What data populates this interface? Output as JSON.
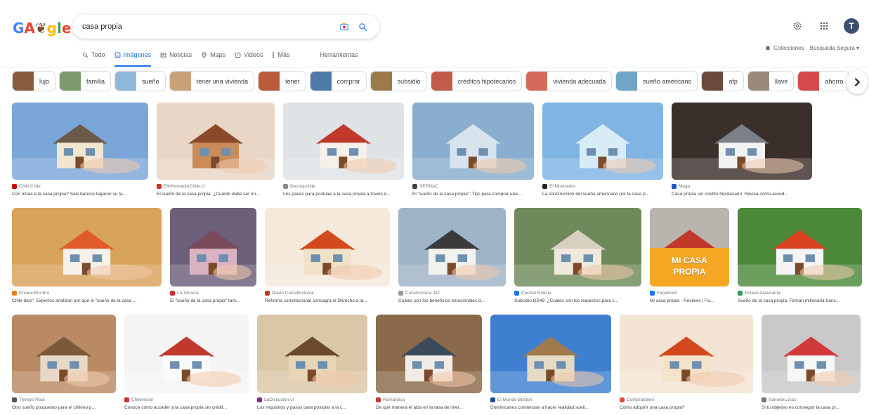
{
  "header": {
    "logo": [
      "G",
      "A",
      "❦",
      "g",
      "l",
      "e"
    ],
    "search_value": "casa propia",
    "avatar_letter": "T"
  },
  "tabs": [
    {
      "label": "Todo",
      "icon": "search-icon"
    },
    {
      "label": "Imágenes",
      "icon": "image-icon",
      "active": true
    },
    {
      "label": "Noticias",
      "icon": "news-icon"
    },
    {
      "label": "Maps",
      "icon": "map-pin-icon"
    },
    {
      "label": "Videos",
      "icon": "video-icon"
    },
    {
      "label": "Más",
      "icon": "more-icon"
    },
    {
      "label": "Herramientas",
      "icon": ""
    }
  ],
  "header_links": {
    "collections": "Colecciones",
    "safe_search": "Búsqueda Segura ▾"
  },
  "chips": [
    {
      "label": "lujo",
      "color": "#8a5a3c"
    },
    {
      "label": "familia",
      "color": "#7c9a6b"
    },
    {
      "label": "sueño",
      "color": "#8fb8d8"
    },
    {
      "label": "tener una vivienda",
      "color": "#c9a27a"
    },
    {
      "label": "tener",
      "color": "#b85c3a"
    },
    {
      "label": "comprar",
      "color": "#4f7aa8"
    },
    {
      "label": "subsidio",
      "color": "#9c7b4a"
    },
    {
      "label": "créditos hipotecarios",
      "color": "#c35b4a"
    },
    {
      "label": "vivienda adecuada",
      "color": "#d46a5a"
    },
    {
      "label": "sueño americano",
      "color": "#6fa6c7"
    },
    {
      "label": "afp",
      "color": "#6a4a3a"
    },
    {
      "label": "llave",
      "color": "#9a8a7a"
    },
    {
      "label": "ahorro",
      "color": "#d44a4a"
    }
  ],
  "rows": [
    [
      {
        "source": "CNN Chile",
        "title": "Con miras a la casa propia? Seis bancos bajaron su ta...",
        "bg": "#7aa7d8",
        "house": "#f1e6d0",
        "roof": "#6b5a4a",
        "favicon": "#cc0000"
      },
      {
        "source": "ElinformadorChile.cl",
        "title": "El sueño de la casa propia: ¿Cuánto debe ser mi...",
        "bg": "#e9d6c6",
        "house": "#c98c5a",
        "roof": "#8a4a2a",
        "favicon": "#d0312d"
      },
      {
        "source": "Decoopchile",
        "title": "Los pasos para postular a la casa propia a través d...",
        "bg": "#dfe3e6",
        "house": "#f4f0ea",
        "roof": "#c0392b",
        "favicon": "#8a8a8a"
      },
      {
        "source": "SERNAC",
        "title": "El \"sueño de la casa propia\": Tips para comprar una ...",
        "bg": "#8aaecf",
        "house": "#d7e4ee",
        "roof": "#d7e4ee",
        "favicon": "#444444"
      },
      {
        "source": "El Mostrador",
        "title": "La construcción del sueño americano por la casa p...",
        "bg": "#7fb4e3",
        "house": "#d8ecf7",
        "roof": "#d8ecf7",
        "favicon": "#222222"
      },
      {
        "source": "Mega",
        "title": "Casa propia sin crédito hipotecario: Revisa cómo acced...",
        "bg": "#3b2f2c",
        "house": "#f2f2f2",
        "roof": "#7a8088",
        "favicon": "#1a56c4"
      }
    ],
    [
      {
        "source": "Enlace Bío Bío",
        "title": "Chile dice\": Expertos analizan por qué el \"sueño de la casa ...",
        "bg": "#d8a35a",
        "house": "#f6f1ea",
        "roof": "#e05a2a",
        "favicon": "#e8811a"
      },
      {
        "source": "La Tercera",
        "title": "El \"sueño de la casa propia\" tam...",
        "bg": "#6d5f7a",
        "house": "#d9b3c2",
        "roof": "#7a4a5a",
        "favicon": "#d0312d"
      },
      {
        "source": "Diario Constitucional -",
        "title": "Reforma constitucional consagra el Derecho a la...",
        "bg": "#f5e9dc",
        "house": "#f0e1c8",
        "roof": "#d3491f",
        "favicon": "#c0392b"
      },
      {
        "source": "Constructora JJJ",
        "title": "Cuáles son los beneficios emocionales d...",
        "bg": "#9fb3c6",
        "house": "#f1f1ee",
        "roof": "#3a3a3a",
        "favicon": "#999999"
      },
      {
        "source": "Central Noticia",
        "title": "Subsidio DS49: ¿Cuáles son los requisitos para c...",
        "bg": "#6f8a5a",
        "house": "#efe8dc",
        "roof": "#d9cfbf",
        "favicon": "#1a73e8"
      },
      {
        "source": "Facebook",
        "title": "Mi casa propia - Reviews | Fa...",
        "bg": "#b9b4ad",
        "house": "#e9e4dc",
        "roof": "#c0392b",
        "favicon": "#1877f2",
        "banner_line1": "MI CASA",
        "banner_line2": "PROPIA"
      },
      {
        "source": "Enlace Araucanía",
        "title": "Sueño de la casa propia: Firman millonaria trans...",
        "bg": "#4c8a3a",
        "house": "#f4f4f4",
        "roof": "#d9401f",
        "favicon": "#2e9d5a"
      }
    ],
    [
      {
        "source": "Tiempo Real",
        "title": "Otro sueño pospuesto para el chileno p...",
        "bg": "#b98a63",
        "house": "#e8d9c7",
        "roof": "#7a5a3a",
        "favicon": "#555555"
      },
      {
        "source": "Chilevisión",
        "title": "Conoce cómo acceder a la casa propia sin crédit...",
        "bg": "#f4f4f4",
        "house": "#fafafa",
        "roof": "#c0392b",
        "favicon": "#d0312d"
      },
      {
        "source": "LaDiscusión.cl",
        "title": "Los requisitos y pasos para postular a la c...",
        "bg": "#d9c7a8",
        "house": "#e7d5b5",
        "roof": "#6a4a2a",
        "favicon": "#8a2a8a"
      },
      {
        "source": "Romántica",
        "title": "De qué manera el alza en la tasa de inter...",
        "bg": "#8a6a4a",
        "house": "#f1ede6",
        "roof": "#3a4a5a",
        "favicon": "#c0392b"
      },
      {
        "source": "El Mundo Boston",
        "title": "Dominicanos comienzan a hacer realidad suell...",
        "bg": "#3f7fd0",
        "house": "#e6dcc6",
        "roof": "#a07a4a",
        "favicon": "#1a4a9a"
      },
      {
        "source": "Compraebien",
        "title": "Cómo adquirir una casa propia?",
        "bg": "#f3e4d4",
        "house": "#f4e3c8",
        "roof": "#d3491f",
        "favicon": "#e84a3a"
      },
      {
        "source": "SanodeLucas",
        "title": "Si tu objetivo es conseguir la casa pr...",
        "bg": "#c9c9c9",
        "house": "#f6f6f6",
        "roof": "#d23a3a",
        "favicon": "#777777"
      }
    ]
  ]
}
